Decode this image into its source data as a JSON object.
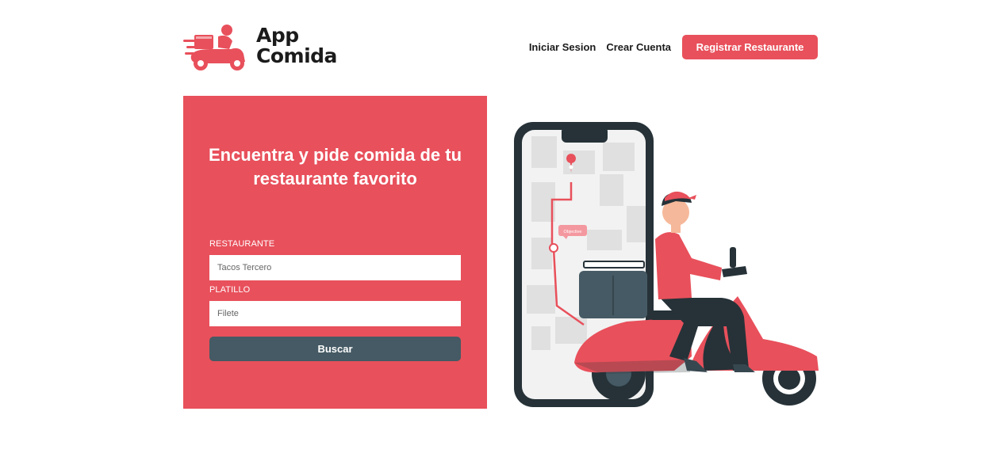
{
  "brand": {
    "line1": "App",
    "line2": "Comida",
    "logo_icon": "delivery-scooter-icon",
    "accent_color": "#e8505b"
  },
  "nav": {
    "login": "Iniciar Sesion",
    "signup": "Crear Cuenta",
    "register_restaurant": "Registrar Restaurante"
  },
  "search_panel": {
    "title": "Encuentra y pide comida de tu restaurante favorito",
    "restaurant_label": "RESTAURANTE",
    "restaurant_placeholder": "Tacos Tercero",
    "dish_label": "PLATILLO",
    "dish_placeholder": "Filete",
    "search_button": "Buscar",
    "panel_color": "#e8505b",
    "button_color": "#455a64"
  },
  "illustration": {
    "map_tag": "Objective"
  }
}
